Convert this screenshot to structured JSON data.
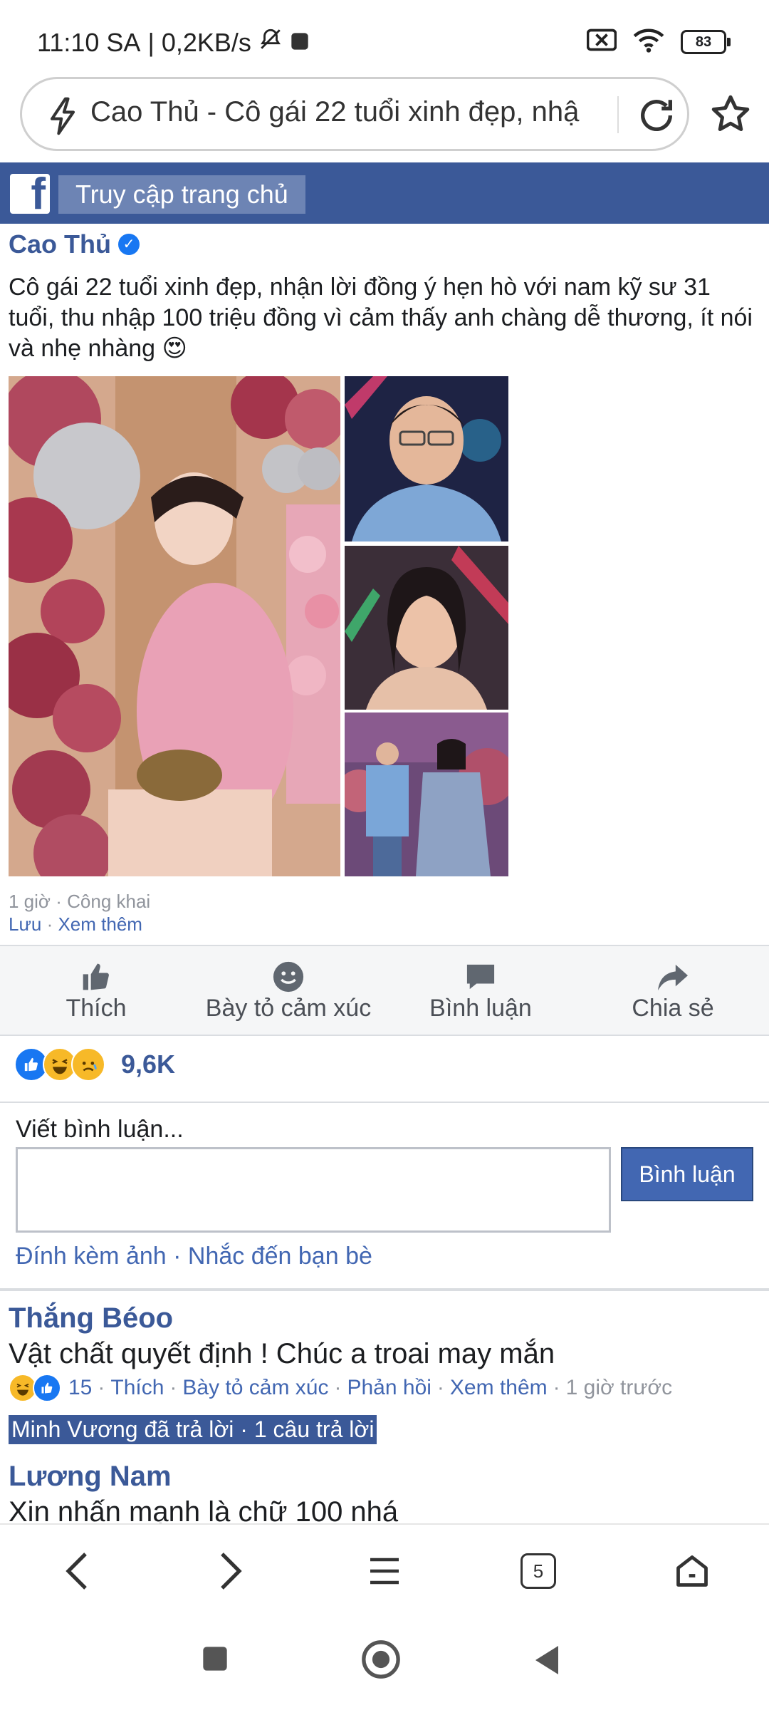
{
  "status_bar": {
    "time": "11:10 SA",
    "separator": "|",
    "speed": "0,2KB/s",
    "battery": "83"
  },
  "address_bar": {
    "title": "Cao Thủ - Cô gái 22 tuổi xinh đẹp, nhậ"
  },
  "fb_header": {
    "logo_letter": "f",
    "home_label": "Truy cập trang chủ"
  },
  "post": {
    "author": "Cao Thủ",
    "verified_mark": "✓",
    "text": "Cô gái 22 tuổi xinh đẹp, nhận lời đồng ý hẹn hò với nam kỹ sư 31 tuổi, thu nhập 100 triệu đồng vì cảm thấy anh chàng dễ thương, ít nói và nhẹ nhàng 😍",
    "time": "1 giờ",
    "dot": "·",
    "privacy": "Công khai",
    "save": "Lưu",
    "see_more": "Xem thêm"
  },
  "actions": [
    {
      "label": "Thích",
      "icon": "like-icon"
    },
    {
      "label": "Bày tỏ cảm xúc",
      "icon": "smiley-icon"
    },
    {
      "label": "Bình luận",
      "icon": "comment-icon"
    },
    {
      "label": "Chia sẻ",
      "icon": "share-icon"
    }
  ],
  "reactions": {
    "count": "9,6K",
    "types": [
      "like",
      "haha",
      "sad"
    ]
  },
  "comment_form": {
    "label": "Viết bình luận...",
    "submit": "Bình luận",
    "attach": "Đính kèm ảnh",
    "dot": "·",
    "mention": "Nhắc đến bạn bè"
  },
  "comments": [
    {
      "name": "Thắng Béoo",
      "text": "Vật chất quyết định ! Chúc a troai may mắn",
      "react_count": "15",
      "like": "Thích",
      "react": "Bày tỏ cảm xúc",
      "reply": "Phản hồi",
      "more": "Xem thêm",
      "time": "1 giờ trước",
      "dot": "·",
      "reply_line": "Minh Vương đã trả lời · 1 câu trả lời"
    },
    {
      "name": "Lương Nam",
      "text": "Xin nhấn mạnh là chữ 100 nhá"
    }
  ],
  "bottom_nav": {
    "tabs_count": "5"
  },
  "colors": {
    "fb_blue": "#3b5998",
    "link_blue": "#4267b2",
    "button_blue": "#4267b2"
  }
}
